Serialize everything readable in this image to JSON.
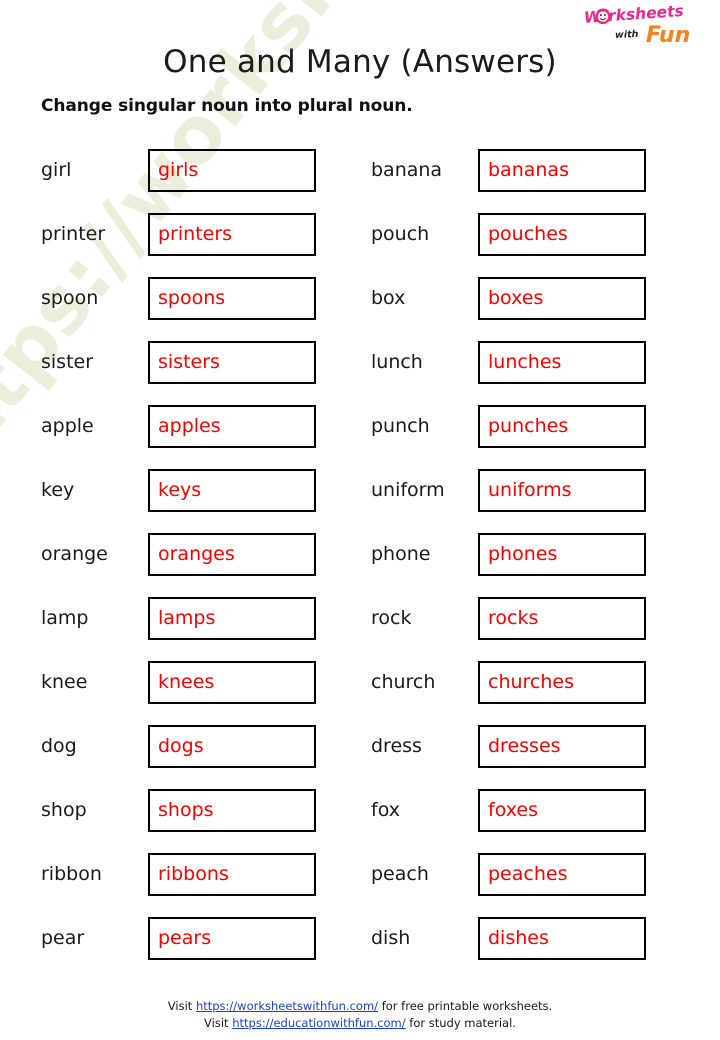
{
  "logo": {
    "word1": "Worksheets",
    "word2": "with",
    "word3": "Fun",
    "colors": {
      "word1": "#ec268f",
      "word2": "#231f20",
      "word3": "#f58220"
    },
    "icon_name": "smiley-face-logo-icon"
  },
  "header": {
    "title": "One and Many (Answers)",
    "instruction": "Change singular noun into plural noun."
  },
  "watermark": {
    "text": "https://worksheetswithfun.com",
    "color": "#ecedda"
  },
  "colors": {
    "answer_text": "#fa0000",
    "box_border": "#000000",
    "label_text": "#1a1a1a",
    "link": "#1a3fd4"
  },
  "columns": {
    "left": [
      {
        "singular": "girl",
        "plural": "girls"
      },
      {
        "singular": "printer",
        "plural": "printers"
      },
      {
        "singular": "spoon",
        "plural": "spoons"
      },
      {
        "singular": "sister",
        "plural": "sisters"
      },
      {
        "singular": "apple",
        "plural": "apples"
      },
      {
        "singular": "key",
        "plural": "keys"
      },
      {
        "singular": "orange",
        "plural": "oranges"
      },
      {
        "singular": "lamp",
        "plural": "lamps"
      },
      {
        "singular": "knee",
        "plural": "knees"
      },
      {
        "singular": "dog",
        "plural": "dogs"
      },
      {
        "singular": "shop",
        "plural": "shops"
      },
      {
        "singular": "ribbon",
        "plural": "ribbons"
      },
      {
        "singular": "pear",
        "plural": "pears"
      }
    ],
    "right": [
      {
        "singular": "banana",
        "plural": "bananas"
      },
      {
        "singular": "pouch",
        "plural": "pouches"
      },
      {
        "singular": "box",
        "plural": "boxes"
      },
      {
        "singular": "lunch",
        "plural": "lunches"
      },
      {
        "singular": "punch",
        "plural": "punches"
      },
      {
        "singular": "uniform",
        "plural": "uniforms"
      },
      {
        "singular": "phone",
        "plural": "phones"
      },
      {
        "singular": "rock",
        "plural": "rocks"
      },
      {
        "singular": "church",
        "plural": "churches"
      },
      {
        "singular": "dress",
        "plural": "dresses"
      },
      {
        "singular": "fox",
        "plural": "foxes"
      },
      {
        "singular": "peach",
        "plural": "peaches"
      },
      {
        "singular": "dish",
        "plural": "dishes"
      }
    ]
  },
  "footer": {
    "line1_prefix": "Visit ",
    "line1_link": "https://worksheetswithfun.com/",
    "line1_suffix": " for free printable worksheets.",
    "line2_prefix": "Visit ",
    "line2_link": "https://educationwithfun.com/",
    "line2_suffix": "  for study material."
  }
}
